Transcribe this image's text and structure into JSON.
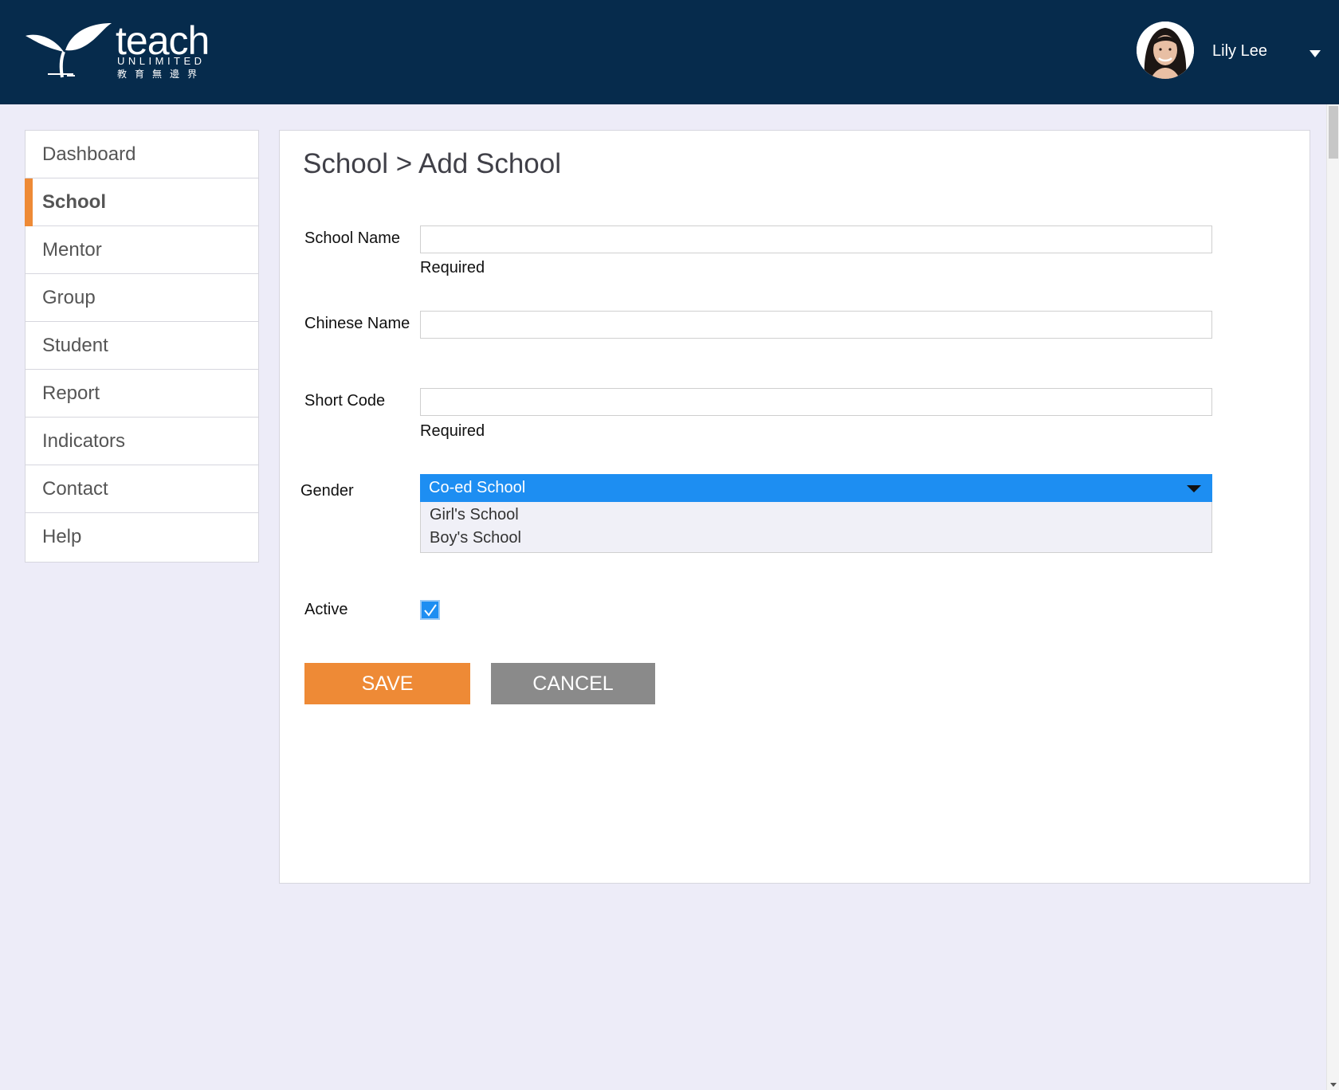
{
  "header": {
    "logo": {
      "main": "teach",
      "sub": "UNLIMITED",
      "chinese": "教育無邊界"
    },
    "user": {
      "name": "Lily Lee"
    }
  },
  "sidebar": {
    "items": [
      {
        "label": "Dashboard"
      },
      {
        "label": "School"
      },
      {
        "label": "Mentor"
      },
      {
        "label": "Group"
      },
      {
        "label": "Student"
      },
      {
        "label": "Report"
      },
      {
        "label": "Indicators"
      },
      {
        "label": "Contact"
      },
      {
        "label": "Help"
      }
    ],
    "active": "School"
  },
  "main": {
    "title": "School > Add School",
    "form": {
      "school_name": {
        "label": "School Name",
        "value": "",
        "hint": "Required"
      },
      "chinese_name": {
        "label": "Chinese Name",
        "value": ""
      },
      "short_code": {
        "label": "Short Code",
        "value": "",
        "hint": "Required"
      },
      "gender": {
        "label": "Gender",
        "selected": "Co-ed School",
        "options": [
          "Girl's School",
          "Boy's School"
        ]
      },
      "active": {
        "label": "Active",
        "checked": true
      }
    },
    "buttons": {
      "save": "SAVE",
      "cancel": "CANCEL"
    }
  },
  "colors": {
    "header_bg": "#062b4c",
    "accent": "#ee8a36",
    "select_blue": "#1d8ef2",
    "cancel_gray": "#8a8a8a",
    "page_bg": "#edecf8"
  }
}
